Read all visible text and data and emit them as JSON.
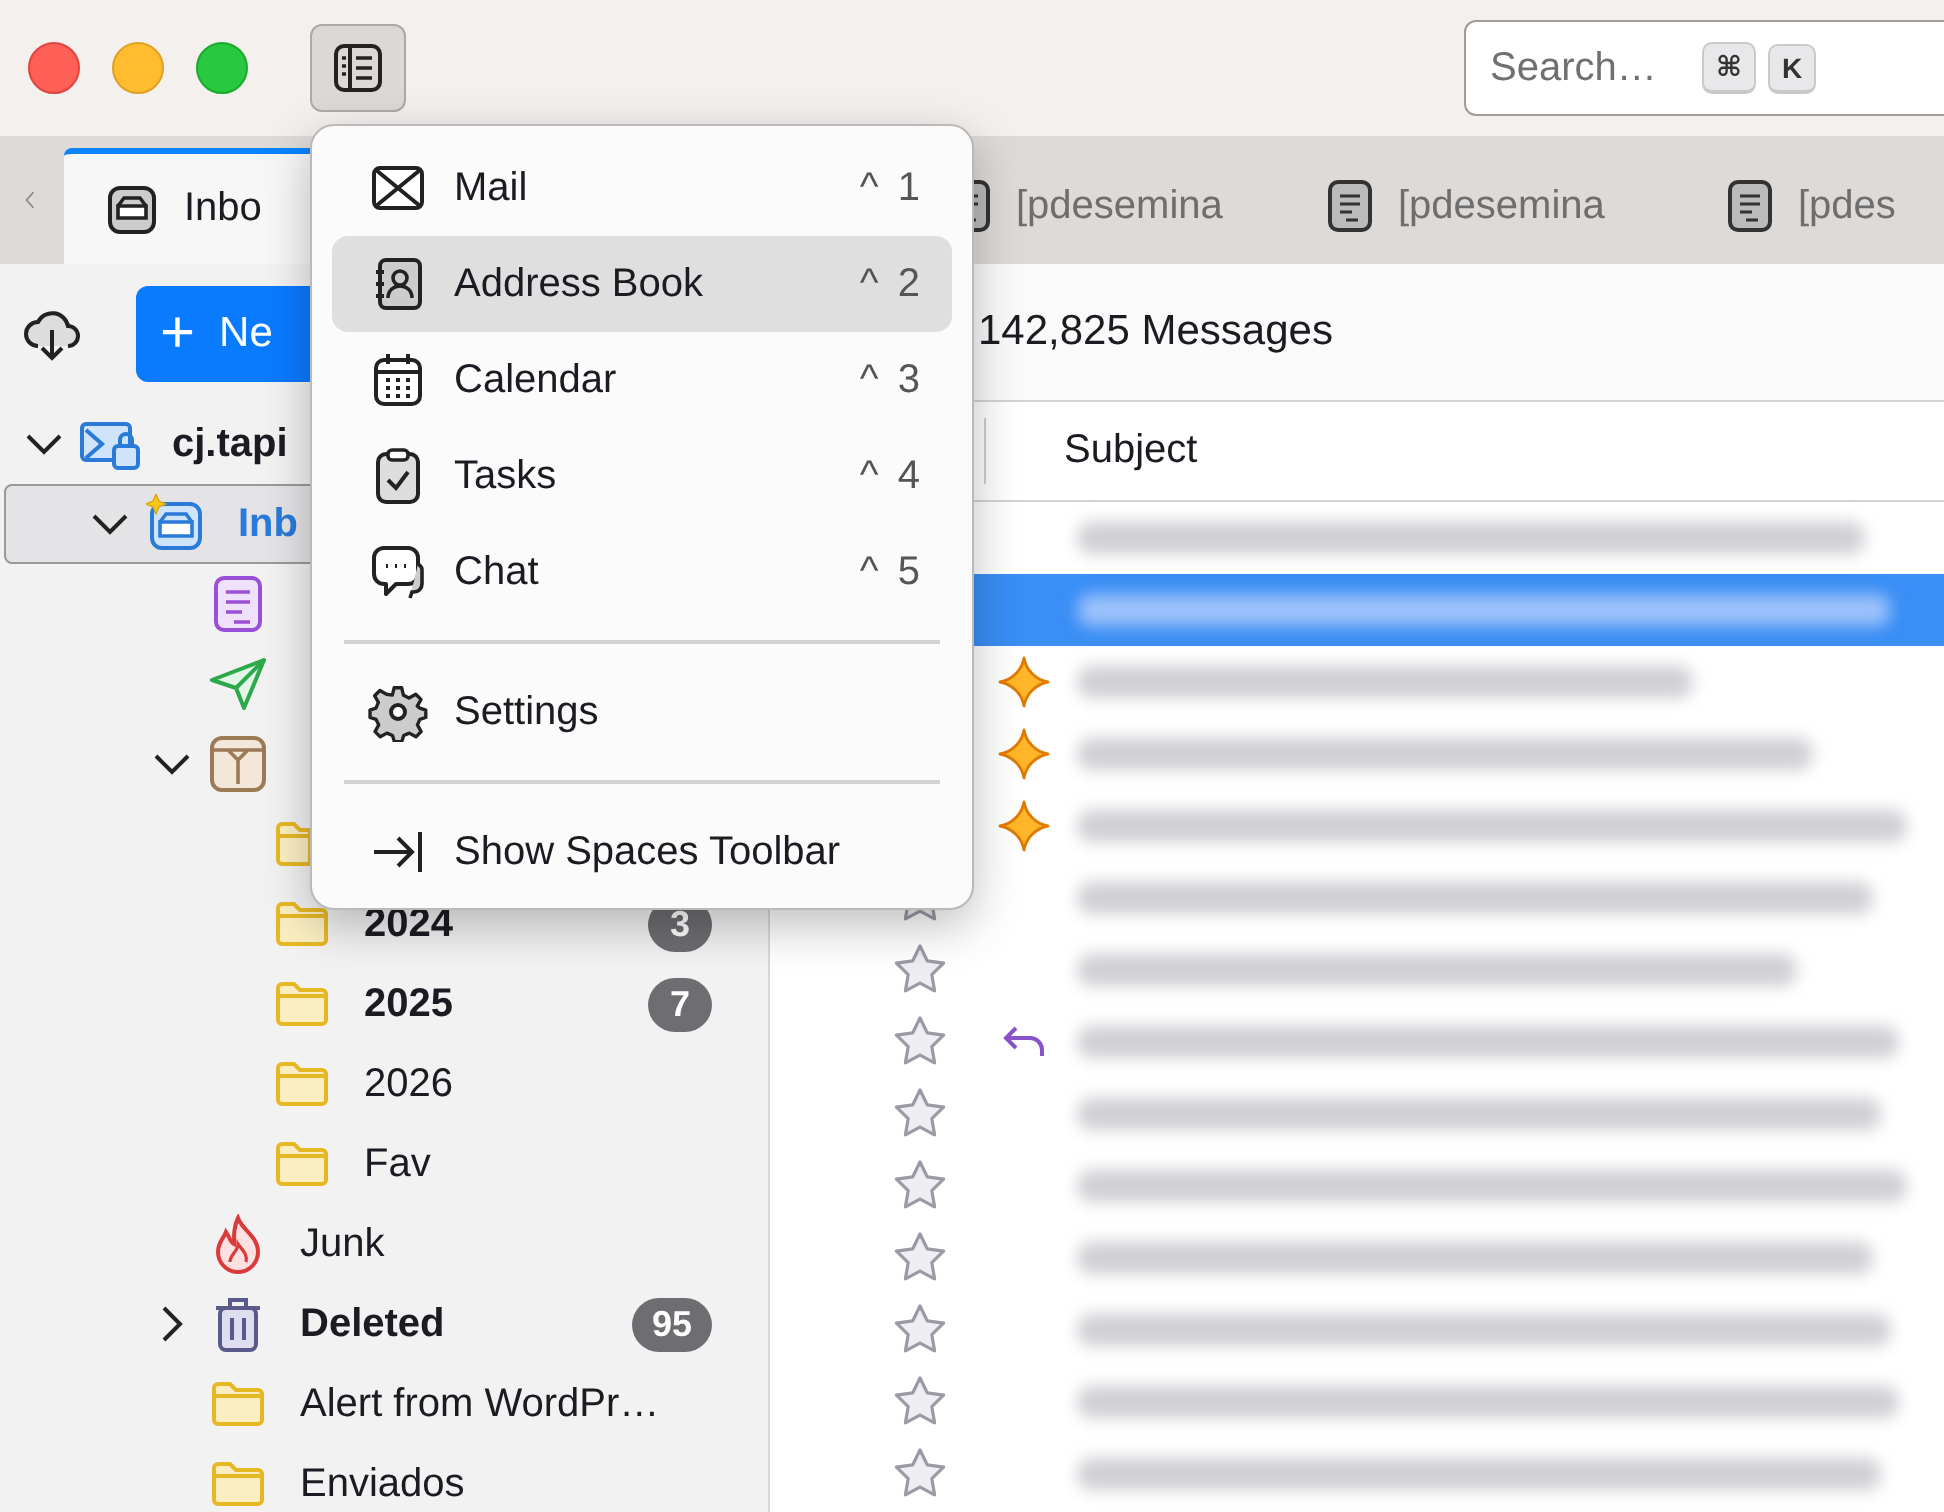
{
  "toolbar": {
    "sidebar_toggle": {
      "pressed": true
    },
    "search": {
      "placeholder": "Search…",
      "keys": [
        "⌘",
        "K"
      ]
    }
  },
  "tabs": [
    {
      "kind": "inbox",
      "label": "Inbo",
      "selected": true
    },
    {
      "kind": "message",
      "label": "[pdesemina",
      "selected": false
    },
    {
      "kind": "message",
      "label": "[pdesemina",
      "selected": false
    },
    {
      "kind": "message",
      "label": "[pdes",
      "selected": false
    }
  ],
  "spaces_menu": {
    "items": [
      {
        "kind": "mail",
        "label": "Mail",
        "shortcut": "^ 1",
        "highlighted": false
      },
      {
        "kind": "address-book",
        "label": "Address Book",
        "shortcut": "^ 2",
        "highlighted": true
      },
      {
        "kind": "calendar",
        "label": "Calendar",
        "shortcut": "^ 3",
        "highlighted": false
      },
      {
        "kind": "tasks",
        "label": "Tasks",
        "shortcut": "^ 4",
        "highlighted": false
      },
      {
        "kind": "chat",
        "label": "Chat",
        "shortcut": "^ 5",
        "highlighted": false
      },
      {
        "kind": "separator"
      },
      {
        "kind": "settings",
        "label": "Settings",
        "highlighted": false
      },
      {
        "kind": "separator"
      },
      {
        "kind": "show-toolbar",
        "label": "Show Spaces Toolbar",
        "highlighted": false
      }
    ]
  },
  "sidebar": {
    "new_button": {
      "symbol": "+",
      "label": "Ne"
    },
    "folders": [
      {
        "kind": "account",
        "label": "cj.tapi",
        "bold": true,
        "selected": false,
        "expanded": true,
        "children": [
          {
            "kind": "inbox",
            "label": "Inb",
            "bold": true,
            "selected": true,
            "new_mail": true,
            "expanded": true,
            "children": [
              {
                "kind": "drafts",
                "selected": false
              },
              {
                "kind": "sent",
                "selected": false
              },
              {
                "kind": "archive",
                "selected": false,
                "expanded": true,
                "children": [
                  {
                    "kind": "folder",
                    "selected": false
                  },
                  {
                    "kind": "folder",
                    "label": "2024",
                    "bold": true,
                    "selected": false,
                    "count": "3"
                  },
                  {
                    "kind": "folder",
                    "label": "2025",
                    "bold": true,
                    "selected": false,
                    "count": "7"
                  },
                  {
                    "kind": "folder",
                    "label": "2026",
                    "bold": false,
                    "selected": false
                  },
                  {
                    "kind": "folder",
                    "label": "Fav",
                    "bold": false,
                    "selected": false
                  }
                ]
              },
              {
                "kind": "junk",
                "label": "Junk",
                "bold": false,
                "selected": false
              },
              {
                "kind": "trash",
                "label": "Deleted",
                "bold": true,
                "selected": false,
                "expanded": false,
                "count": "95"
              },
              {
                "kind": "folder",
                "label": "Alert from WordPr…",
                "bold": false,
                "selected": false
              },
              {
                "kind": "folder",
                "label": "Enviados",
                "bold": false,
                "selected": false
              }
            ]
          }
        ]
      }
    ]
  },
  "message_list": {
    "count": "142,825 Messages",
    "columns": [
      "Subject"
    ],
    "rows": [
      {
        "kind": "plain",
        "selected": false
      },
      {
        "kind": "plain",
        "selected": true
      },
      {
        "kind": "new",
        "selected": false
      },
      {
        "kind": "new",
        "selected": false
      },
      {
        "kind": "new",
        "selected": false
      },
      {
        "kind": "plain",
        "selected": false,
        "starred": false
      },
      {
        "kind": "plain",
        "selected": false,
        "starred": false
      },
      {
        "kind": "replied",
        "selected": false,
        "starred": false
      },
      {
        "kind": "plain",
        "selected": false,
        "starred": false
      },
      {
        "kind": "plain",
        "selected": false,
        "starred": false
      },
      {
        "kind": "plain",
        "selected": false,
        "starred": false
      },
      {
        "kind": "plain",
        "selected": false,
        "starred": false
      },
      {
        "kind": "plain",
        "selected": false,
        "starred": false
      },
      {
        "kind": "plain",
        "selected": false,
        "starred": false
      }
    ]
  }
}
